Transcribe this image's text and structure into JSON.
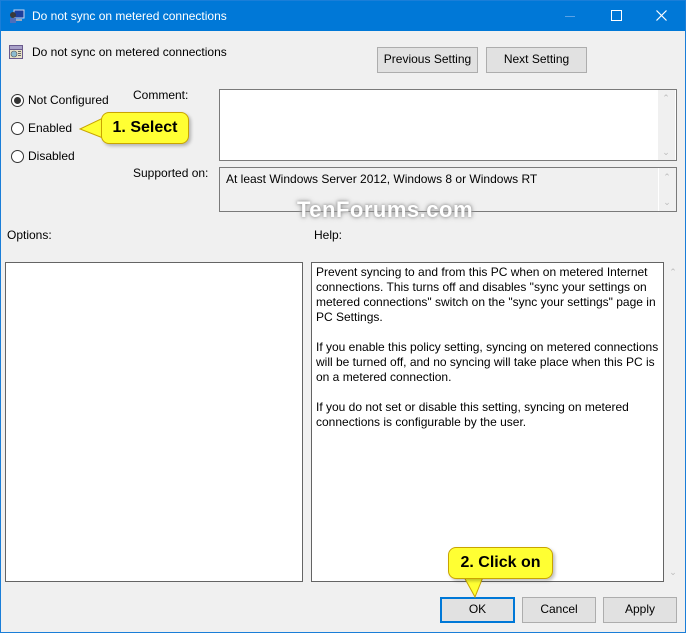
{
  "window": {
    "title": "Do not sync on metered connections",
    "controls": {
      "minimize": "minimize",
      "maximize": "maximize",
      "close": "close"
    }
  },
  "header": {
    "policy_name": "Do not sync on metered connections",
    "previous_label": "Previous Setting",
    "next_label": "Next Setting"
  },
  "state": {
    "options": [
      {
        "label": "Not Configured",
        "checked": true
      },
      {
        "label": "Enabled",
        "checked": false
      },
      {
        "label": "Disabled",
        "checked": false
      }
    ]
  },
  "comment": {
    "label": "Comment:",
    "value": ""
  },
  "supported": {
    "label": "Supported on:",
    "value": "At least Windows Server 2012, Windows 8 or Windows RT"
  },
  "options_section": {
    "label": "Options:"
  },
  "help_section": {
    "label": "Help:",
    "paragraphs": [
      "Prevent syncing to and from this PC when on metered Internet connections.  This turns off and disables \"sync your settings on metered connections\" switch on the \"sync your settings\" page in PC Settings.",
      "If you enable this policy setting, syncing on metered connections will be turned off, and no syncing will take place when this PC is on a metered connection.",
      "If you do not set or disable this setting, syncing on metered connections is configurable by the user."
    ]
  },
  "footer": {
    "ok_label": "OK",
    "cancel_label": "Cancel",
    "apply_label": "Apply"
  },
  "annotations": {
    "step1": "1. Select",
    "step2": "2. Click on",
    "watermark": "TenForums.com",
    "callout_color": "#ffff33"
  },
  "colors": {
    "titlebar": "#0078d7",
    "window_bg": "#f0f0f0",
    "default_button_border": "#0078d7"
  }
}
